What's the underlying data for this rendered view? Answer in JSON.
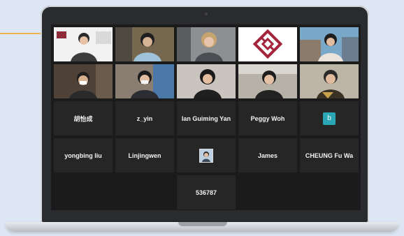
{
  "meeting": {
    "participants": [
      {
        "name": "",
        "tag": "",
        "type": "video"
      },
      {
        "name": "",
        "tag": "",
        "type": "video"
      },
      {
        "name": "",
        "tag": "",
        "type": "video"
      },
      {
        "name": "",
        "tag": "",
        "type": "logo"
      },
      {
        "name": "",
        "tag": "",
        "type": "video"
      },
      {
        "name": "",
        "tag": "",
        "type": "video"
      },
      {
        "name": "",
        "tag": "",
        "type": "video"
      },
      {
        "name": "",
        "tag": "",
        "type": "video"
      },
      {
        "name": "",
        "tag": "",
        "type": "video"
      },
      {
        "name": "",
        "tag": "",
        "type": "video"
      },
      {
        "name": "胡怡成",
        "tag": "",
        "type": "name"
      },
      {
        "name": "z_yin",
        "tag": "",
        "type": "name"
      },
      {
        "name": "Ian Guiming Yan",
        "tag": "",
        "type": "name"
      },
      {
        "name": "Peggy Woh",
        "tag": "",
        "type": "name"
      },
      {
        "name": "b",
        "tag": "",
        "type": "initial"
      },
      {
        "name": "yongbing liu",
        "tag": "",
        "type": "name"
      },
      {
        "name": "Linjingwen",
        "tag": "",
        "type": "name"
      },
      {
        "name": "",
        "tag": "",
        "type": "photo"
      },
      {
        "name": "James",
        "tag": "",
        "type": "name"
      },
      {
        "name": "CHEUNG Fu Wa",
        "tag": "",
        "type": "name"
      },
      {
        "name": "536787",
        "tag": "",
        "type": "name"
      }
    ]
  }
}
